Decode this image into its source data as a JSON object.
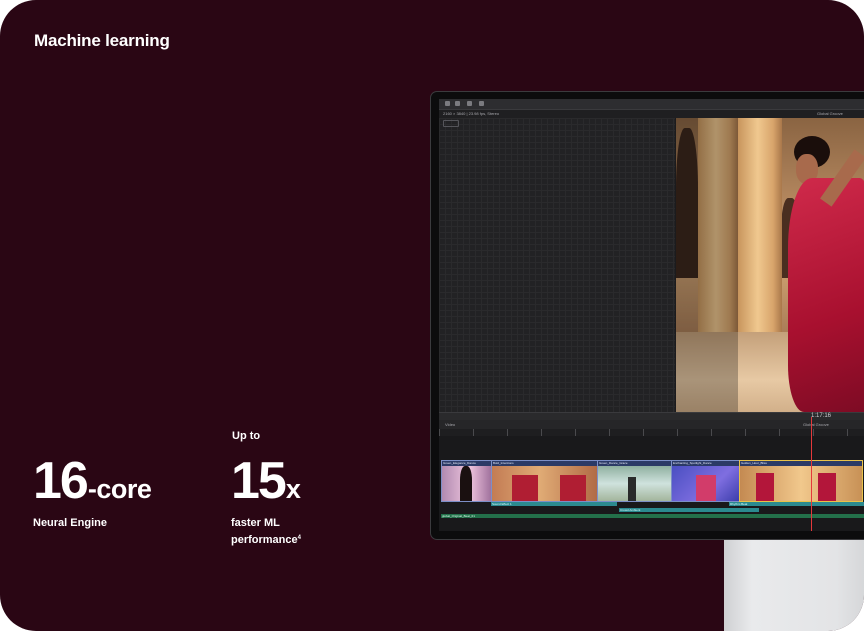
{
  "section_title": "Machine learning",
  "stat1": {
    "value": "16",
    "suffix": "-core",
    "caption": "Neural Engine"
  },
  "stat2": {
    "prefix": "Up to",
    "value": "15",
    "suffix": "x",
    "caption_line1": "faster ML",
    "caption_line2": "performance",
    "footnote": "4"
  },
  "app": {
    "format_info": "2160 × 3840 | 23.98 fps, Stereo",
    "project_name": "Global Groove",
    "timecode": "1:17:16",
    "index_label": "Video",
    "timeline_project": "Global Groove",
    "clips": [
      "Green_Elegance_Dance",
      "Bold_Intentions",
      "Green_Dance_Grace",
      "Enchanting_Spotlight_Dance",
      "Golden_Hour_Bliss"
    ],
    "audio_clips": [
      "Sound Effect 1",
      "Crowd Ambient",
      "Rhythm Beat"
    ],
    "music_track": "global_Original_Beat_01"
  },
  "colors": {
    "background": "#2a0614",
    "text": "#ffffff",
    "clip_border": "#7c8fc7",
    "playhead": "#e5383b"
  }
}
